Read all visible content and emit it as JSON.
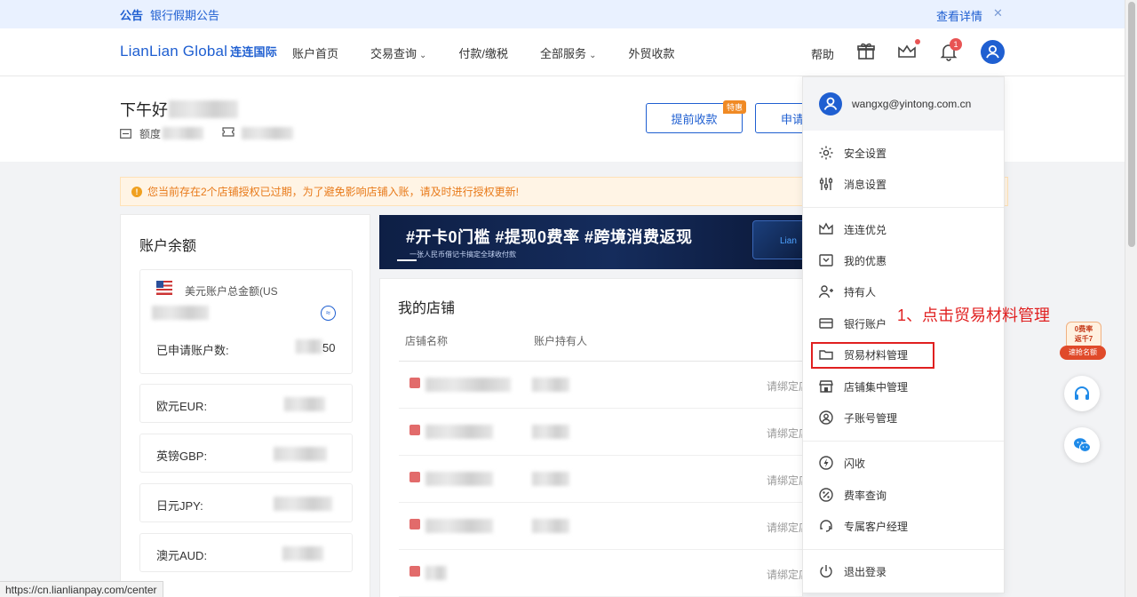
{
  "notice": {
    "tag": "公告",
    "text": "银行假期公告",
    "more": "查看详情",
    "close": "✕"
  },
  "header": {
    "logo": "LianLian Global",
    "logo_cn": "连连国际",
    "nav": [
      {
        "label": "账户首页"
      },
      {
        "label": "交易查询",
        "chevron": true
      },
      {
        "label": "付款/缴税"
      },
      {
        "label": "全部服务",
        "chevron": true
      },
      {
        "label": "外贸收款"
      }
    ],
    "help": "帮助",
    "notification_count": "1",
    "chevron_glyph": "⌄"
  },
  "top": {
    "greeting": "下午好",
    "quota_label": "额度",
    "buttons": {
      "early_collect": "提前收款",
      "hot_badge": "特惠",
      "apply": "申请"
    }
  },
  "warning": {
    "icon": "!",
    "text": "您当前存在2个店铺授权已过期，为了避免影响店铺入账，请及时进行授权更新!"
  },
  "balance": {
    "title": "账户余额",
    "total_label": "美元账户总金额(US",
    "convert_icon": "≈",
    "applied_label": "已申请账户数:",
    "applied_value": "50",
    "currencies": [
      "欧元EUR:",
      "英镑GBP:",
      "日元JPY:",
      "澳元AUD:"
    ]
  },
  "banner": {
    "headline": "#开卡0门槛 #提现0费率 #跨境消费返现",
    "sub": "一张人民币借记卡搞定全球收付款",
    "card_text": "Lian"
  },
  "shop": {
    "title": "我的店铺",
    "columns": [
      "店铺名称",
      "账户持有人"
    ],
    "rows": [
      {
        "bind": "请绑定店"
      },
      {
        "bind": "请绑定店"
      },
      {
        "bind": "请绑定店"
      },
      {
        "bind": "请绑定店"
      },
      {
        "bind": "请绑定店"
      }
    ]
  },
  "menu": {
    "email": "wangxg@yintong.com.cn",
    "items": [
      {
        "label": "安全设置",
        "icon": "gear-icon"
      },
      {
        "label": "消息设置",
        "icon": "sliders-icon"
      },
      {
        "label": "连连优兑",
        "icon": "crown-icon"
      },
      {
        "label": "我的优惠",
        "icon": "coupon-icon"
      },
      {
        "label": "持有人",
        "icon": "person-add-icon"
      },
      {
        "label": "银行账户",
        "icon": "card-icon"
      },
      {
        "label": "贸易材料管理",
        "icon": "folder-icon"
      },
      {
        "label": "店铺集中管理",
        "icon": "shop-icon"
      },
      {
        "label": "子账号管理",
        "icon": "user-circle-icon"
      },
      {
        "label": "闪收",
        "icon": "bolt-icon"
      },
      {
        "label": "费率查询",
        "icon": "percent-icon"
      },
      {
        "label": "专属客户经理",
        "icon": "manager-icon"
      },
      {
        "label": "退出登录",
        "icon": "power-icon"
      }
    ]
  },
  "annotation": "1、点击贸易材料管理",
  "promo": {
    "top": "0费率\n返千7",
    "bottom": "速抢名额"
  },
  "status_url": "https://cn.lianlianpay.com/center",
  "colors": {
    "brand": "#1f5fd1",
    "highlight": "#e02020",
    "warning": "#e87a1a"
  }
}
